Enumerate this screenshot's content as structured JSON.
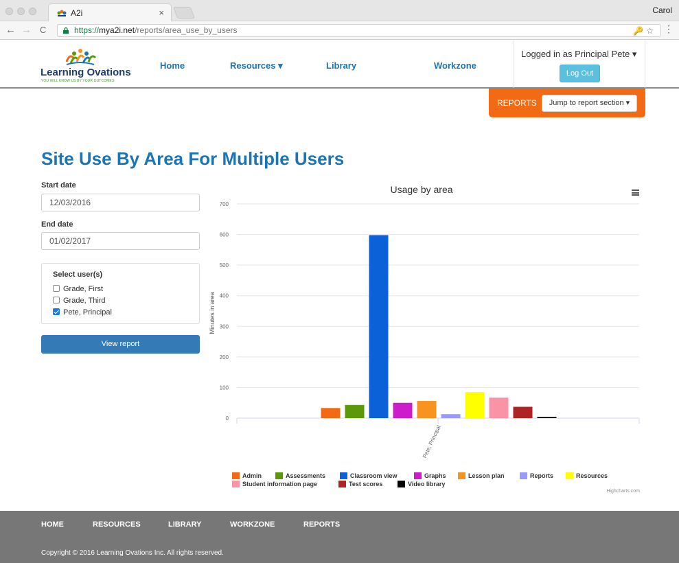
{
  "browser": {
    "tab_title": "A2i",
    "tab_close": "×",
    "profile_name": "Carol",
    "url_scheme": "https://",
    "url_host": "mya2i.net",
    "url_path": "/reports/area_use_by_users",
    "back_icon": "←",
    "forward_icon": "→",
    "reload_icon": "C",
    "omnibox_icons": "🔑☆",
    "menu_icon": "⋮"
  },
  "header": {
    "logo_name": "Learning Ovations",
    "logo_tagline": "YOU WILL KNOW US BY YOUR OUTCOMES",
    "nav": {
      "home": "Home",
      "resources": "Resources ▾",
      "library": "Library",
      "workzone": "Workzone"
    },
    "logged_in_text": "Logged in as Principal Pete ▾",
    "logout_label": "Log Out",
    "reports_label": "REPORTS",
    "jump_label": "Jump to report section ▾"
  },
  "main": {
    "title": "Site Use By Area For Multiple Users",
    "start_label": "Start date",
    "start_value": "12/03/2016",
    "end_label": "End date",
    "end_value": "01/02/2017",
    "users_title": "Select user(s)",
    "users": [
      {
        "name": "Grade, First",
        "checked": false
      },
      {
        "name": "Grade, Third",
        "checked": false
      },
      {
        "name": "Pete, Principal",
        "checked": true
      }
    ],
    "view_label": "View report",
    "credit": "Highcharts.com"
  },
  "chart_data": {
    "type": "bar",
    "title": "Usage by area",
    "ylabel": "Minutes in area",
    "ylim": [
      0,
      700
    ],
    "yticks": [
      0,
      100,
      200,
      300,
      400,
      500,
      600,
      700
    ],
    "categories": [
      "Pete, Principal"
    ],
    "grid": true,
    "legend_position": "bottom",
    "series": [
      {
        "name": "Admin",
        "color": "#f26a14",
        "values": [
          33
        ]
      },
      {
        "name": "Assessments",
        "color": "#5a9a0a",
        "values": [
          43
        ]
      },
      {
        "name": "Classroom view",
        "color": "#0b61d8",
        "values": [
          598
        ]
      },
      {
        "name": "Graphs",
        "color": "#cc1ccc",
        "values": [
          50
        ]
      },
      {
        "name": "Lesson plan",
        "color": "#f7931e",
        "values": [
          56
        ]
      },
      {
        "name": "Reports",
        "color": "#9999ff",
        "values": [
          13
        ]
      },
      {
        "name": "Resources",
        "color": "#ffff00",
        "values": [
          85
        ]
      },
      {
        "name": "Student information page",
        "color": "#f993a5",
        "values": [
          67
        ]
      },
      {
        "name": "Test scores",
        "color": "#b02323",
        "values": [
          37
        ]
      },
      {
        "name": "Video library",
        "color": "#000000",
        "values": [
          4
        ]
      }
    ]
  },
  "footer": {
    "links": [
      "HOME",
      "RESOURCES",
      "LIBRARY",
      "WORKZONE",
      "REPORTS"
    ],
    "copyright": "Copyright © 2016 Learning Ovations Inc. All rights reserved."
  }
}
